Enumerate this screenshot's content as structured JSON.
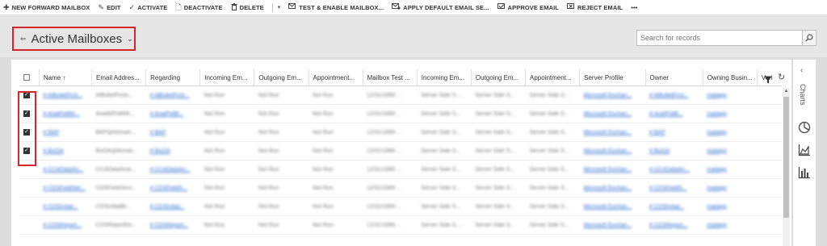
{
  "command_bar": {
    "items": [
      {
        "icon": "plus-icon",
        "label": "NEW FORWARD MAILBOX"
      },
      {
        "icon": "pencil-icon",
        "label": "EDIT"
      },
      {
        "icon": "checkmark-icon",
        "label": "ACTIVATE"
      },
      {
        "icon": "document-icon",
        "label": "DEACTIVATE"
      },
      {
        "icon": "trash-icon",
        "label": "DELETE"
      },
      {
        "icon": "mail-check-icon",
        "label": "TEST & ENABLE MAILBOX..."
      },
      {
        "icon": "mail-settings-icon",
        "label": "APPLY DEFAULT EMAIL SE..."
      },
      {
        "icon": "approve-icon",
        "label": "APPROVE EMAIL"
      },
      {
        "icon": "reject-icon",
        "label": "REJECT EMAIL"
      }
    ],
    "more": "•••"
  },
  "view": {
    "title": "Active Mailboxes",
    "pin_glyph": "⇐",
    "chevron_glyph": "⌄"
  },
  "search": {
    "placeholder": "Search for records"
  },
  "grid": {
    "columns": [
      "Name ↑",
      "Email Addres...",
      "Regarding",
      "Incoming Em...",
      "Outgoing Em...",
      "Appointment...",
      "Mailbox Test ...",
      "Incoming Em...",
      "Outgoing Em...",
      "Appointment...",
      "Server Profile",
      "Owner",
      "Owning Busin...",
      "Veri"
    ],
    "rows": [
      {
        "selected": true,
        "cells": [
          "# AlBulletFirst...",
          "AlBulletFirsts...",
          "# AlBulletFirst...",
          "Not Run",
          "Not Run",
          "Not Run",
          "12/31/1899 ...",
          "Server Side S...",
          "Server Side S...",
          "Server Side S...",
          "Microsoft Exchan...",
          "# AlBulletFirst...",
          "mailapp"
        ]
      },
      {
        "selected": true,
        "cells": [
          "# ArialPollWi...",
          "ArialWPollWk...",
          "# ArialPollB...",
          "Not Run",
          "Not Run",
          "Not Run",
          "12/31/1899 ...",
          "Server Side S...",
          "Server Side S...",
          "Server Side S...",
          "Microsoft Exchan...",
          "# ArialPollB...",
          "mailapp"
        ]
      },
      {
        "selected": true,
        "cells": [
          "# BAP",
          "BAP@domain...",
          "# BAP",
          "Not Run",
          "Not Run",
          "Not Run",
          "12/31/1899 ...",
          "Server Side S...",
          "Server Side S...",
          "Server Side S...",
          "Microsoft Exchan...",
          "# BAP",
          "mailapp"
        ]
      },
      {
        "selected": true,
        "cells": [
          "# BizDA",
          "BizDA@domai...",
          "# BizDA",
          "Not Run",
          "Not Run",
          "Not Run",
          "12/31/1899 ...",
          "Server Side S...",
          "Server Side S...",
          "Server Side S...",
          "Microsoft Exchan...",
          "# BizDA",
          "mailapp"
        ]
      },
      {
        "selected": false,
        "cells": [
          "# CCADataAn...",
          "CCADataAnal...",
          "# CCADataAn...",
          "Not Run",
          "Not Run",
          "Not Run",
          "12/31/1899 ...",
          "Server Side S...",
          "Server Side S...",
          "Server Side S...",
          "Microsoft Exchan...",
          "# CCADataAn...",
          "mailapp"
        ]
      },
      {
        "selected": false,
        "cells": [
          "# CDSFieldSer...",
          "CDSFieldServ...",
          "# CDSFieldS...",
          "Not Run",
          "Not Run",
          "Not Run",
          "12/31/1899 ...",
          "Server Side S...",
          "Server Side S...",
          "Server Side S...",
          "Microsoft Exchan...",
          "# CDSFieldS...",
          "mailapp"
        ]
      },
      {
        "selected": false,
        "cells": [
          "# CDSInitial...",
          "CDSInitialBr...",
          "# CDSInitial...",
          "Not Run",
          "Not Run",
          "Not Run",
          "12/31/1899 ...",
          "Server Side S...",
          "Server Side S...",
          "Server Side S...",
          "Microsoft Exchan...",
          "# CDSInitial...",
          "mailapp"
        ]
      },
      {
        "selected": false,
        "cells": [
          "# CDSReport...",
          "CDSReportDe...",
          "# CDSReport...",
          "Not Run",
          "Not Run",
          "Not Run",
          "12/31/1899 ...",
          "Server Side S...",
          "Server Side S...",
          "Server Side S...",
          "Microsoft Exchan...",
          "# CDSReport...",
          "mailapp"
        ]
      }
    ]
  },
  "charts_pane": {
    "label": "Charts",
    "collapse_glyph": "‹"
  }
}
